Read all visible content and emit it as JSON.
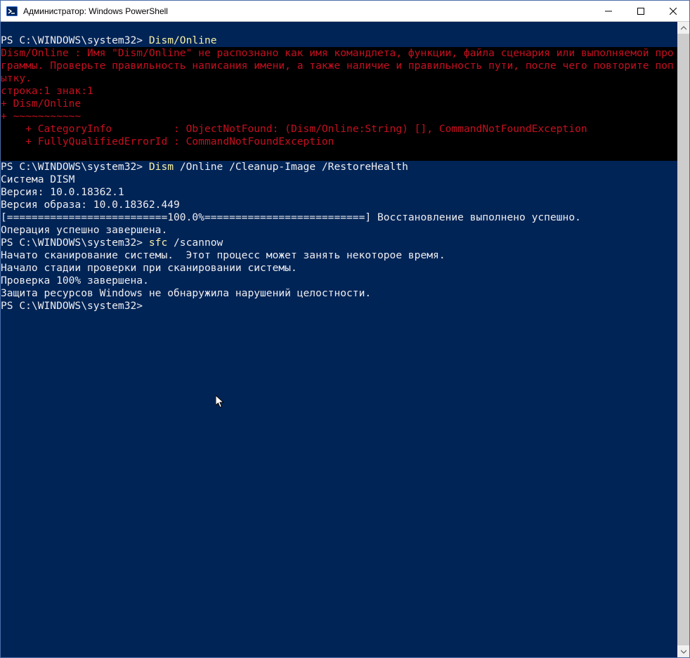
{
  "window": {
    "title": "Администратор: Windows PowerShell"
  },
  "colors": {
    "bg": "#012456",
    "errbg": "#000000",
    "red": "#c50f1f",
    "yellow": "#f9f1a5",
    "fg": "#eeedf0"
  },
  "prompt": "PS C:\\WINDOWS\\system32> ",
  "session": {
    "cmd1": "Dism/Online",
    "err": {
      "l1": "Dism/Online : Имя \"Dism/Online\" не распознано как имя командлета, функции, файла сценария или выполняемой программы. Проверьте правильность написания имени, а также наличие и правильность пути, после чего повторите попытку.",
      "l2": "строка:1 знак:1",
      "l3": "+ Dism/Online",
      "l4": "+ ~~~~~~~~~~~",
      "l5": "    + CategoryInfo          : ObjectNotFound: (Dism/Online:String) [], CommandNotFoundException",
      "l6": "    + FullyQualifiedErrorId : CommandNotFoundException",
      "blank": " "
    },
    "cmd2_cmd": "Dism",
    "cmd2_args": " /Online /Cleanup-Image /RestoreHealth",
    "dism": {
      "blank1": "",
      "l1": "Cистема DISM",
      "l2": "Версия: 10.0.18362.1",
      "blank2": "",
      "l3": "Версия образа: 10.0.18362.449",
      "blank3": "",
      "l4": "[==========================100.0%==========================] Восстановление выполнено успешно.",
      "l5": "Операция успешно завершена."
    },
    "cmd3_cmd": "sfc",
    "cmd3_args": " /scannow",
    "sfc": {
      "blank1": "",
      "l1": "Начато сканирование системы.  Этот процесс может занять некоторое время.",
      "blank2": "",
      "l2": "Начало стадии проверки при сканировании системы.",
      "l3": "Проверка 100% завершена.",
      "blank3": "",
      "l4": "Защита ресурсов Windows не обнаружила нарушений целостности."
    },
    "final_prompt": "PS C:\\WINDOWS\\system32> "
  }
}
